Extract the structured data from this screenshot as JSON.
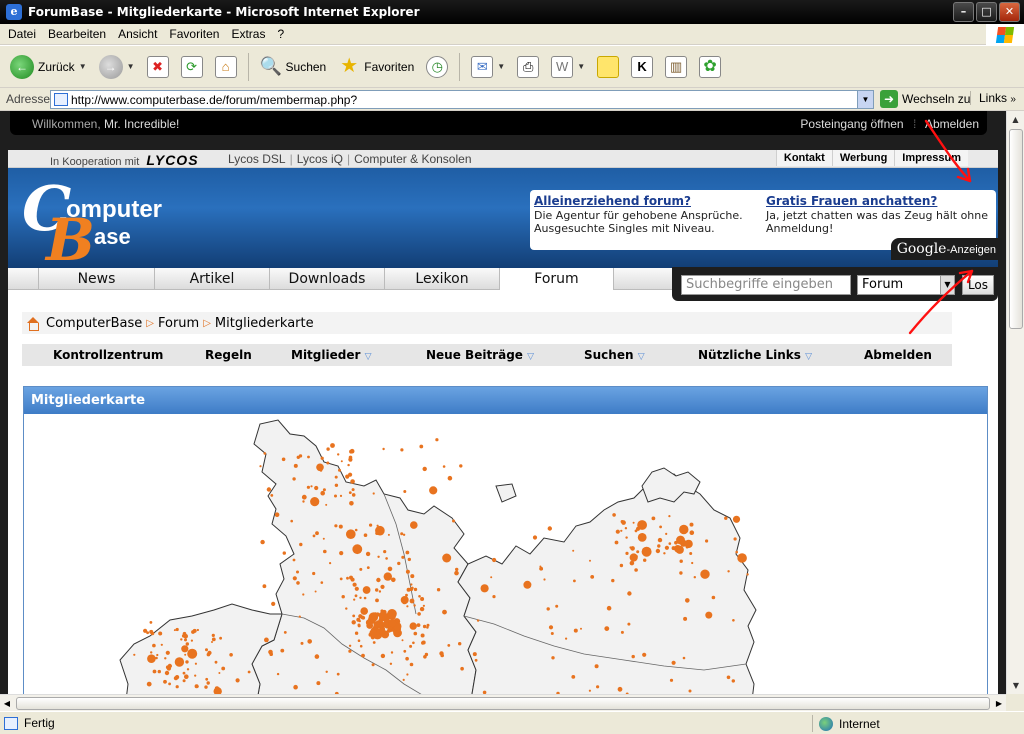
{
  "window": {
    "title": "ForumBase - Mitgliederkarte - Microsoft Internet Explorer",
    "buttons": [
      "minimize",
      "maximize",
      "close"
    ]
  },
  "menu": [
    "Datei",
    "Bearbeiten",
    "Ansicht",
    "Favoriten",
    "Extras",
    "?"
  ],
  "toolbar": {
    "back": "Zurück",
    "search": "Suchen",
    "favorites": "Favoriten"
  },
  "address": {
    "label": "Adresse",
    "url": "http://www.computerbase.de/forum/membermap.php?",
    "go": "Wechseln zu",
    "links": "Links"
  },
  "userbar": {
    "welcome_prefix": "Willkommen,",
    "username": "Mr. Incredible!",
    "inbox": "Posteingang öffnen",
    "logout": "Abmelden"
  },
  "partner": {
    "coop": "In Kooperation mit",
    "brand": "LYCOS",
    "links": [
      "Lycos DSL",
      "Lycos iQ",
      "Computer & Konsolen"
    ],
    "toplinks": [
      "Kontakt",
      "Werbung",
      "Impressum"
    ]
  },
  "logo": {
    "c": "C",
    "omputer": "omputer",
    "b": "B",
    "ase": "ase"
  },
  "ads": [
    {
      "title": "Alleinerziehend forum?",
      "text": "Die Agentur für gehobene Ansprüche. Ausgesuchte Singles mit Niveau."
    },
    {
      "title": "Gratis Frauen anchatten?",
      "text": "Ja, jetzt chatten was das Zeug hält ohne Anmeldung!"
    }
  ],
  "google_ads": {
    "brand": "Google",
    "label": "-Anzeigen"
  },
  "nav": [
    "News",
    "Artikel",
    "Downloads",
    "Lexikon",
    "Forum"
  ],
  "search": {
    "placeholder": "Suchbegriffe eingeben",
    "scope": "Forum",
    "button": "Los"
  },
  "breadcrumb": [
    "ComputerBase",
    "Forum",
    "Mitgliederkarte"
  ],
  "subnav": [
    "Kontrollzentrum",
    "Regeln",
    "Mitglieder",
    "Neue Beiträge",
    "Suchen",
    "Nützliche Links",
    "Abmelden"
  ],
  "panel": {
    "title": "Mitgliederkarte"
  },
  "status": {
    "text": "Fertig",
    "zone": "Internet"
  },
  "colors": {
    "accent": "#e8731f",
    "header_blue": "#2a70bd",
    "annotation": "#ff0000"
  }
}
